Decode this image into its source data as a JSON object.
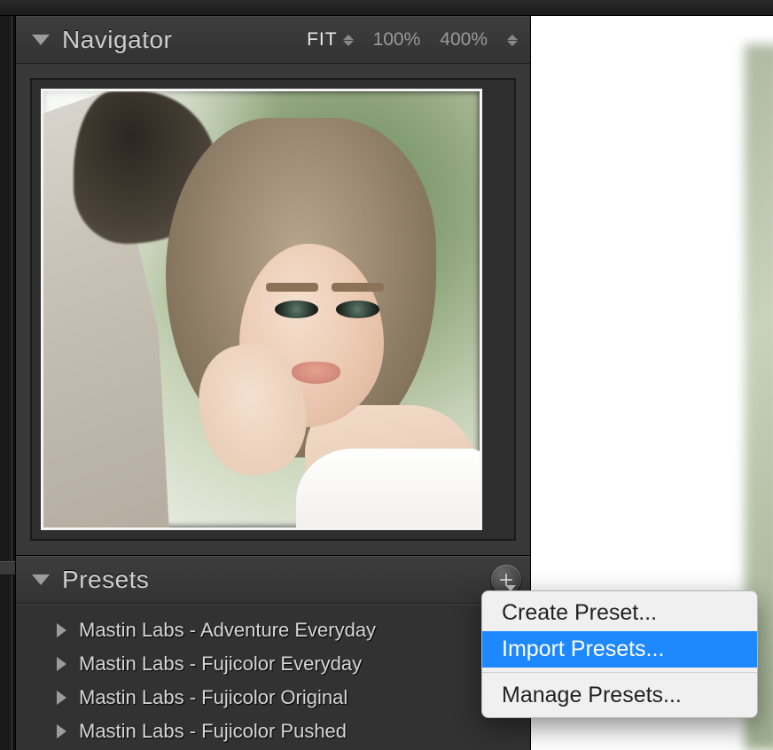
{
  "navigator": {
    "title": "Navigator",
    "zoom": {
      "fit_label": "FIT",
      "level_100": "100%",
      "level_400": "400%"
    }
  },
  "presets": {
    "title": "Presets",
    "groups": [
      {
        "label": "Mastin Labs - Adventure Everyday"
      },
      {
        "label": "Mastin Labs - Fujicolor Everyday"
      },
      {
        "label": "Mastin Labs - Fujicolor Original"
      },
      {
        "label": "Mastin Labs - Fujicolor Pushed"
      }
    ]
  },
  "context_menu": {
    "create": "Create Preset...",
    "import": "Import Presets...",
    "manage": "Manage Presets..."
  }
}
